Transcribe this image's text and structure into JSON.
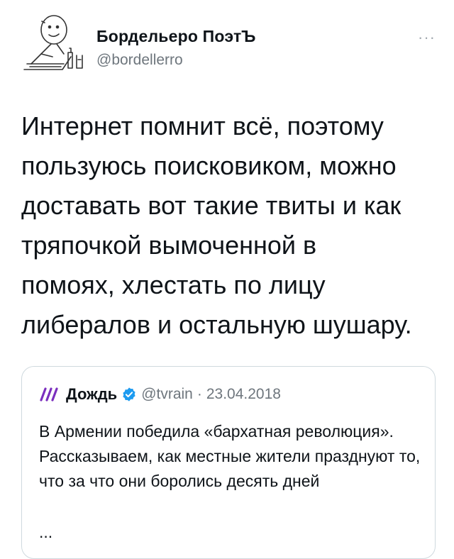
{
  "author": {
    "display_name": "Бордельеро ПоэтЪ",
    "handle": "@bordellerro",
    "more_icon": "ellipsis-icon"
  },
  "tweet": {
    "text": "Интернет помнит всё, поэтому\nпользуюсь поисковиком, можно\nдоставать вот такие твиты и как\nтряпочкой вымоченной в\nпомоях, хлестать по лицу\nлибералов и остальную шушару."
  },
  "quote": {
    "name": "Дождь",
    "handle": "@tvrain",
    "separator": "·",
    "date": "23.04.2018",
    "text": "В Армении победила «бархатная революция». Рассказываем, как местные жители празднуют то, что за что они боролись десять дней",
    "ellipsis": "...",
    "verified_color": "#1d9bf0",
    "logo_color": "#8a2be2"
  },
  "more": "···"
}
